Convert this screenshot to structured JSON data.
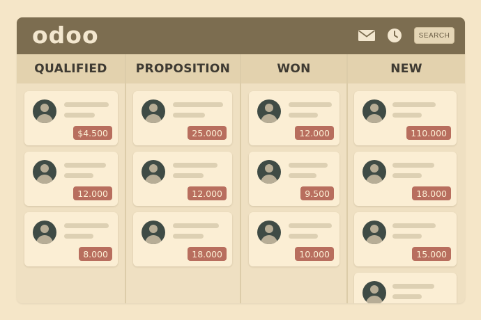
{
  "app": {
    "logo": "odoo"
  },
  "header": {
    "search_label": "SEARCH",
    "icons": [
      "mail-icon",
      "clock-icon"
    ]
  },
  "colors": {
    "topbar": "#7c6d50",
    "column_header": "#e3d2ae",
    "card": "#fbeed4",
    "amount_badge": "#b86e5e",
    "avatar": "#3f4b45"
  },
  "columns": [
    {
      "title": "QUALIFIED",
      "cards": [
        {
          "amount": "$4.500"
        },
        {
          "amount": "12.000"
        },
        {
          "amount": "8.000"
        }
      ]
    },
    {
      "title": "PROPOSITION",
      "cards": [
        {
          "amount": "25.000"
        },
        {
          "amount": "12.000"
        },
        {
          "amount": "18.000"
        }
      ]
    },
    {
      "title": "WON",
      "cards": [
        {
          "amount": "12.000"
        },
        {
          "amount": "9.500"
        },
        {
          "amount": "10.000"
        }
      ]
    },
    {
      "title": "NEW",
      "cards": [
        {
          "amount": "110.000"
        },
        {
          "amount": "18.000"
        },
        {
          "amount": "15.000"
        },
        {
          "amount": ""
        }
      ]
    }
  ]
}
